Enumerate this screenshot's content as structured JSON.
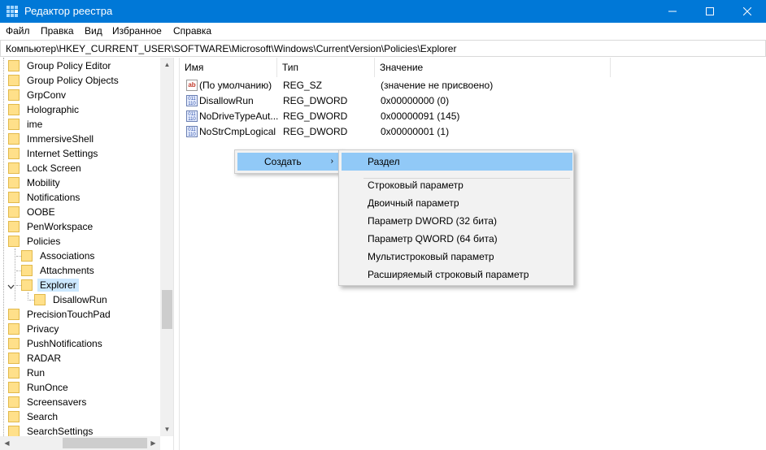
{
  "window": {
    "title": "Редактор реестра"
  },
  "menu": [
    "Файл",
    "Правка",
    "Вид",
    "Избранное",
    "Справка"
  ],
  "address": "Компьютер\\HKEY_CURRENT_USER\\SOFTWARE\\Microsoft\\Windows\\CurrentVersion\\Policies\\Explorer",
  "tree": {
    "items": [
      {
        "label": "Group Policy Editor",
        "level": 0
      },
      {
        "label": "Group Policy Objects",
        "level": 0
      },
      {
        "label": "GrpConv",
        "level": 0
      },
      {
        "label": "Holographic",
        "level": 0
      },
      {
        "label": "ime",
        "level": 0
      },
      {
        "label": "ImmersiveShell",
        "level": 0
      },
      {
        "label": "Internet Settings",
        "level": 0
      },
      {
        "label": "Lock Screen",
        "level": 0
      },
      {
        "label": "Mobility",
        "level": 0
      },
      {
        "label": "Notifications",
        "level": 0
      },
      {
        "label": "OOBE",
        "level": 0
      },
      {
        "label": "PenWorkspace",
        "level": 0
      },
      {
        "label": "Policies",
        "level": 0
      },
      {
        "label": "Associations",
        "level": 1
      },
      {
        "label": "Attachments",
        "level": 1
      },
      {
        "label": "Explorer",
        "level": 1,
        "selected": true,
        "expanded": true
      },
      {
        "label": "DisallowRun",
        "level": 2
      },
      {
        "label": "PrecisionTouchPad",
        "level": 0
      },
      {
        "label": "Privacy",
        "level": 0
      },
      {
        "label": "PushNotifications",
        "level": 0
      },
      {
        "label": "RADAR",
        "level": 0
      },
      {
        "label": "Run",
        "level": 0
      },
      {
        "label": "RunOnce",
        "level": 0
      },
      {
        "label": "Screensavers",
        "level": 0
      },
      {
        "label": "Search",
        "level": 0
      },
      {
        "label": "SearchSettings",
        "level": 0
      }
    ]
  },
  "list": {
    "columns": [
      "Имя",
      "Тип",
      "Значение"
    ],
    "rows": [
      {
        "icon": "string-value-icon",
        "name": "(По умолчанию)",
        "type": "REG_SZ",
        "value": "(значение не присвоено)"
      },
      {
        "icon": "binary-value-icon",
        "name": "DisallowRun",
        "type": "REG_DWORD",
        "value": "0x00000000 (0)"
      },
      {
        "icon": "binary-value-icon",
        "name": "NoDriveTypeAut...",
        "type": "REG_DWORD",
        "value": "0x00000091 (145)"
      },
      {
        "icon": "binary-value-icon",
        "name": "NoStrCmpLogical",
        "type": "REG_DWORD",
        "value": "0x00000001 (1)"
      }
    ]
  },
  "context_menu": {
    "create_label": "Создать",
    "arrow": "›"
  },
  "submenu": {
    "items": [
      "Раздел",
      "Строковый параметр",
      "Двоичный параметр",
      "Параметр DWORD (32 бита)",
      "Параметр QWORD (64 бита)",
      "Мультистроковый параметр",
      "Расширяемый строковый параметр"
    ]
  },
  "colors": {
    "titlebar": "#0078d7",
    "highlight": "#91c9f7",
    "selection": "#cce8ff"
  }
}
